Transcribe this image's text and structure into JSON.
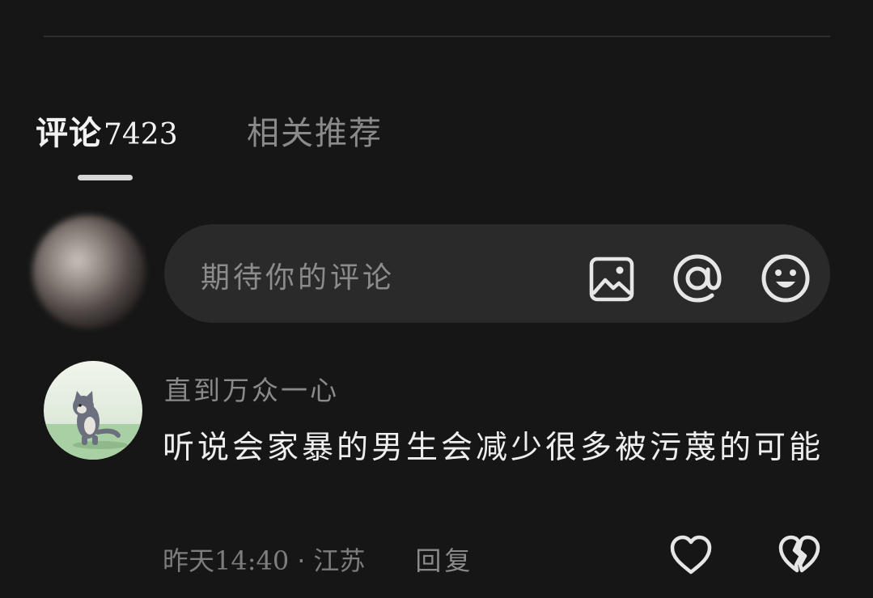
{
  "tabs": {
    "comments_label": "评论",
    "comments_count": "7423",
    "related_label": "相关推荐"
  },
  "composer": {
    "placeholder": "期待你的评论",
    "icons": [
      "image-icon",
      "at-icon",
      "emoji-icon"
    ]
  },
  "comment": {
    "username": "直到万众一心",
    "text": "听说会家暴的男生会减少很多被污蔑的可能",
    "date": "昨天14:40",
    "dot": "·",
    "location": "江苏",
    "reply_label": "回复",
    "icons": [
      "heart-icon",
      "broken-heart-icon"
    ]
  },
  "colors": {
    "background": "#161616",
    "input_background": "#2a2a2a",
    "primary_text": "#eeeeee",
    "secondary_text": "#8a8a8a"
  }
}
